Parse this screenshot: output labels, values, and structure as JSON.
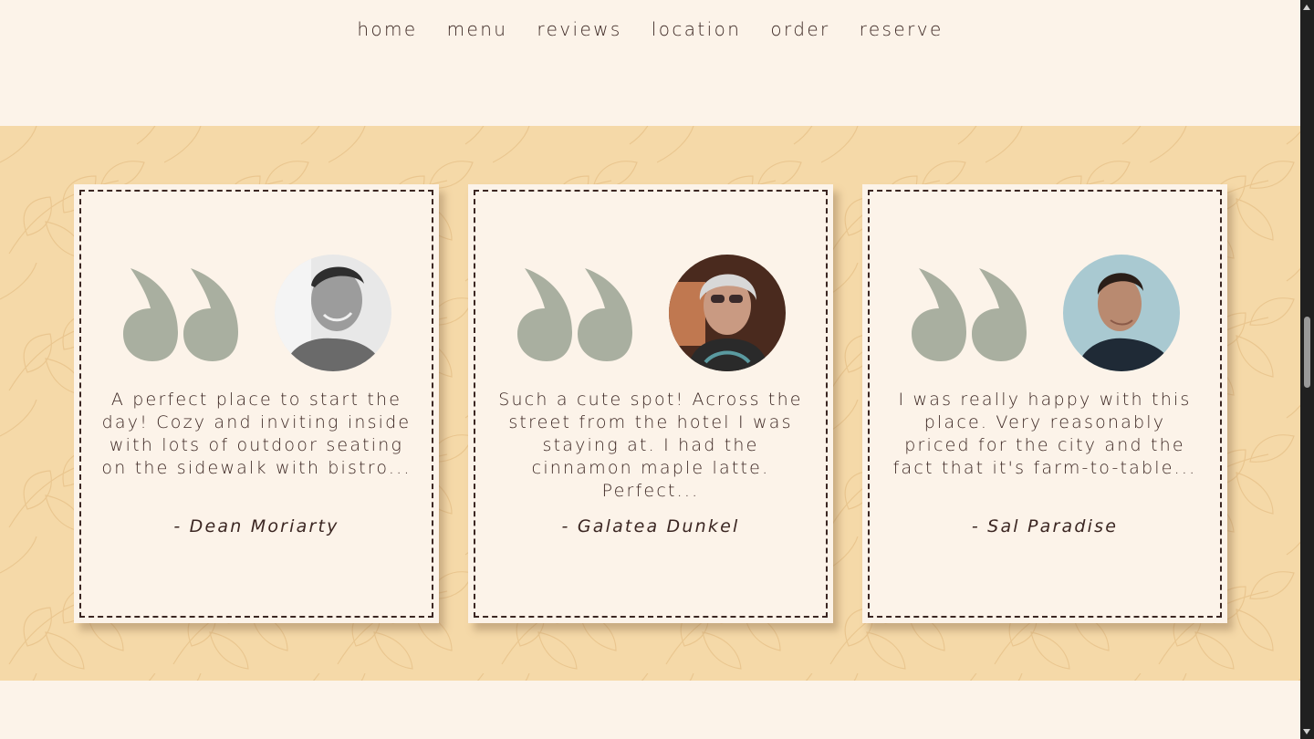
{
  "nav": {
    "items": [
      {
        "label": "home"
      },
      {
        "label": "menu"
      },
      {
        "label": "reviews"
      },
      {
        "label": "location"
      },
      {
        "label": "order"
      },
      {
        "label": "reserve"
      }
    ]
  },
  "reviews": [
    {
      "text": "A perfect place to start the day! Cozy and inviting inside with lots of outdoor seating on the sidewalk with bistro...",
      "author": "- Dean Moriarty"
    },
    {
      "text": "Such a cute spot! Across the street from the hotel I was staying at. I had the cinnamon maple latte. Perfect...",
      "author": "- Galatea Dunkel"
    },
    {
      "text": "I was really happy with this place. Very reasonably priced for the city and the fact that it's farm-to-table...",
      "author": "- Sal Paradise"
    }
  ],
  "colors": {
    "page_bg": "#fcf3e9",
    "section_bg": "#f5d9a8",
    "text": "#3b2622",
    "quote_mark": "#a9afa0"
  }
}
